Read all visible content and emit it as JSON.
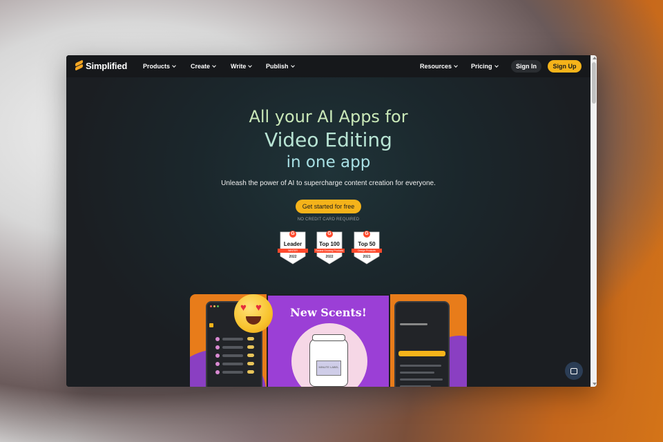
{
  "nav": {
    "brand": "Simplified",
    "items": [
      {
        "label": "Products"
      },
      {
        "label": "Create"
      },
      {
        "label": "Write"
      },
      {
        "label": "Publish"
      },
      {
        "label": "Resources"
      },
      {
        "label": "Pricing"
      }
    ],
    "sign_in": "Sign In",
    "sign_up": "Sign Up"
  },
  "hero": {
    "line1": "All your AI Apps for",
    "line2": "Video Editing",
    "line3": "in one app",
    "subtitle": "Unleash the power of AI to supercharge content creation for everyone.",
    "cta": "Get started for free",
    "note": "NO CREDIT CARD REQUIRED"
  },
  "badges": [
    {
      "title": "Leader",
      "ribbon": "WINTER",
      "year": "2022"
    },
    {
      "title": "Top 100",
      "ribbon": "Fastest Growing Products",
      "year": "2022"
    },
    {
      "title": "Top 50",
      "ribbon": "Design Products",
      "year": "2021"
    }
  ],
  "showcase": {
    "poster_title": "New Scents!",
    "jar_label": "MINUTE LABEL"
  },
  "colors": {
    "accent": "#f5b31a",
    "background": "#1b1e22",
    "poster": "#9b3fd6",
    "orange": "#e87c1a"
  }
}
